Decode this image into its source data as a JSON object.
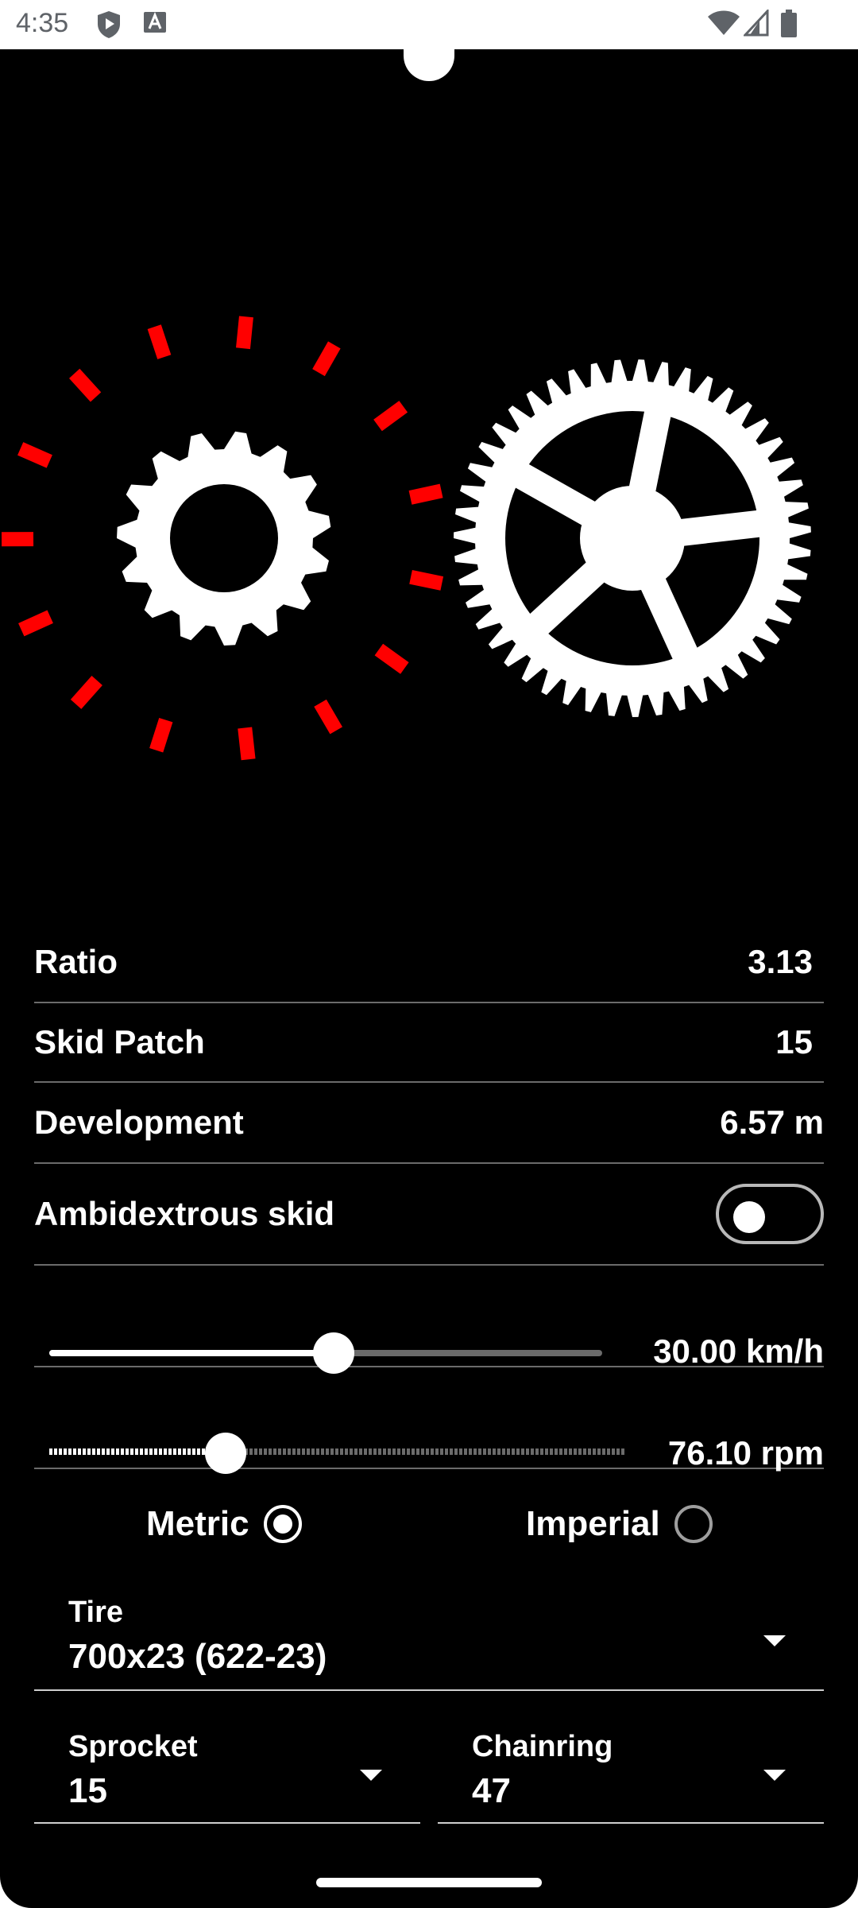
{
  "status_bar": {
    "time": "4:35",
    "icons": [
      "shield-play-icon",
      "font-a-icon",
      "wifi-icon",
      "cell-signal-icon",
      "battery-icon"
    ]
  },
  "stats": {
    "ratio": {
      "label": "Ratio",
      "value": "3.13"
    },
    "skid_patch": {
      "label": "Skid Patch",
      "value": "15"
    },
    "development": {
      "label": "Development",
      "value": "6.57 m"
    },
    "ambidextrous": {
      "label": "Ambidextrous skid",
      "enabled": false
    }
  },
  "speed_slider": {
    "value": "30.00 km/h",
    "level": 0.5
  },
  "cadence_slider": {
    "value": "76.10 rpm",
    "level": 0.3
  },
  "units": {
    "metric_label": "Metric",
    "imperial_label": "Imperial",
    "selected": "metric"
  },
  "tire": {
    "label": "Tire",
    "value": "700x23 (622-23)"
  },
  "sprocket": {
    "label": "Sprocket",
    "value": "15"
  },
  "chainring": {
    "label": "Chainring",
    "value": "47"
  },
  "colors": {
    "background": "#000000",
    "skid_marks": "#ff0000",
    "gear": "#ffffff"
  }
}
